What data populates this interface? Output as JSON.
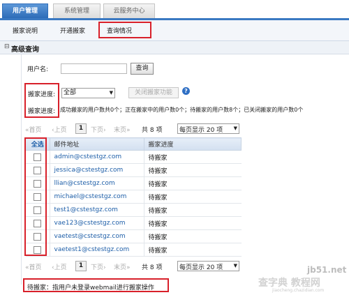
{
  "top_tabs": [
    "用户管理",
    "系统管理",
    "云服务中心"
  ],
  "sub_nav": [
    "搬家说明",
    "开通搬家",
    "查询情况"
  ],
  "section": {
    "toggle": "⊟",
    "title": "高级查询"
  },
  "search": {
    "label": "用户名:",
    "value": "",
    "button": "查询"
  },
  "filter": {
    "label": "搬家进度:",
    "selected": "全部",
    "disabled_button": "关闭搬家功能",
    "help": "?",
    "summary_label": "搬家进度:",
    "summary_text": "成功搬家的用户数共0个；正在搬家中的用户数0个；待搬家的用户数8个；已关闭搬家的用户数0个"
  },
  "pager": {
    "first": "«首页",
    "prev": "‹上页",
    "current": "1",
    "next": "下页›",
    "last": "末页»",
    "total": "共 8 项",
    "per_page": "每页显示 20 项"
  },
  "table": {
    "headers": [
      "全选",
      "邮件地址",
      "搬家进度"
    ],
    "rows": [
      {
        "email": "admin@cstestgz.com",
        "status": "待搬家"
      },
      {
        "email": "jessica@cstestgz.com",
        "status": "待搬家"
      },
      {
        "email": "llian@cstestgz.com",
        "status": "待搬家"
      },
      {
        "email": "michael@cstestgz.com",
        "status": "待搬家"
      },
      {
        "email": "test1@cstestgz.com",
        "status": "待搬家"
      },
      {
        "email": "vae123@cstestgz.com",
        "status": "待搬家"
      },
      {
        "email": "vaetest@cstestgz.com",
        "status": "待搬家"
      },
      {
        "email": "vaetest1@cstestgz.com",
        "status": "待搬家"
      }
    ]
  },
  "footnote": "待搬家：指用户未登录webmail进行搬家操作",
  "watermark": {
    "site": "jb51.net",
    "brand": "查字典 教程网",
    "url": "jiaocheng.chazidian.com"
  },
  "colors": {
    "accent": "#3a79c2",
    "highlight": "#d8202a",
    "link": "#1d5ea8"
  }
}
